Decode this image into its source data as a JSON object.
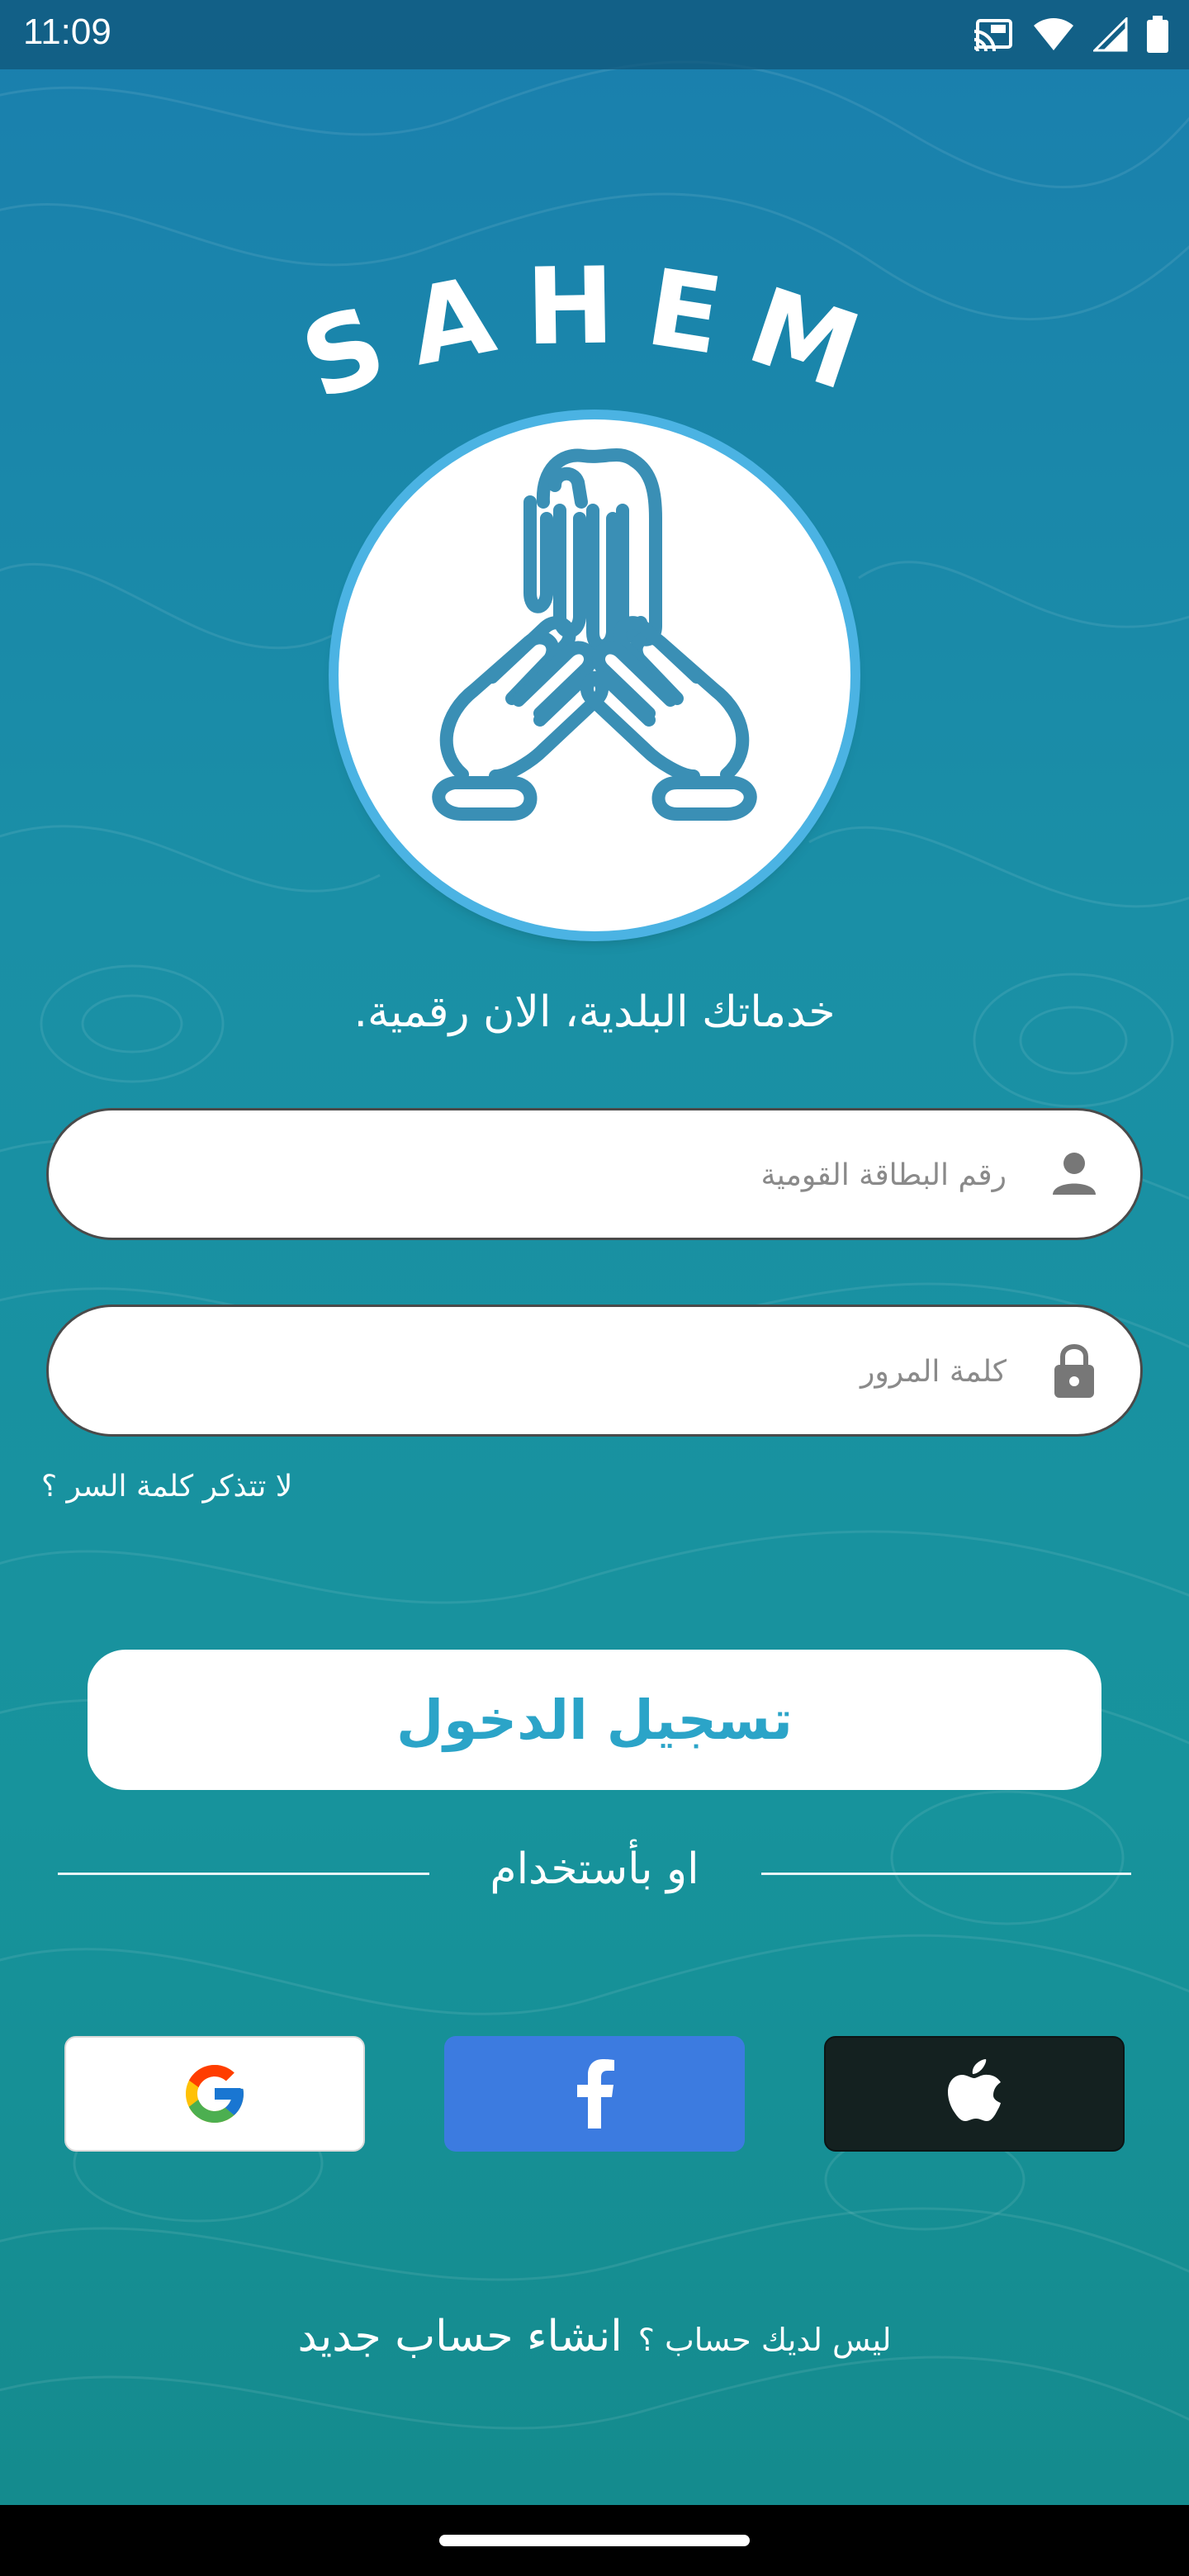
{
  "status_bar": {
    "time": "11:09",
    "icons": [
      "cast-icon",
      "wifi-icon",
      "signal-icon",
      "battery-icon"
    ]
  },
  "brand": {
    "name": "SAHEM",
    "logo": "hands-logo-icon",
    "tagline": "خدماتك البلدية، الان رقمية."
  },
  "form": {
    "national_id": {
      "placeholder": "رقم البطاقة القومية",
      "value": "",
      "icon": "person-icon"
    },
    "password": {
      "placeholder": "كلمة المرور",
      "value": "",
      "icon": "lock-icon"
    },
    "forgot_label": "لا تتذكر كلمة السر ؟",
    "login_label": "تسجيل الدخول"
  },
  "alt_login": {
    "divider_label": "او بأستخدام",
    "providers": [
      "google-icon",
      "facebook-icon",
      "apple-icon"
    ]
  },
  "signup": {
    "question": "ليس لديك حساب ؟",
    "link_label": "انشاء حساب جديد"
  },
  "colors": {
    "background_top": "#1a7fae",
    "background_bottom": "#148a8c",
    "accent": "#2ba4c8",
    "logo_blue": "#3a8fb5",
    "facebook": "#3c7be0",
    "apple": "#142120"
  }
}
